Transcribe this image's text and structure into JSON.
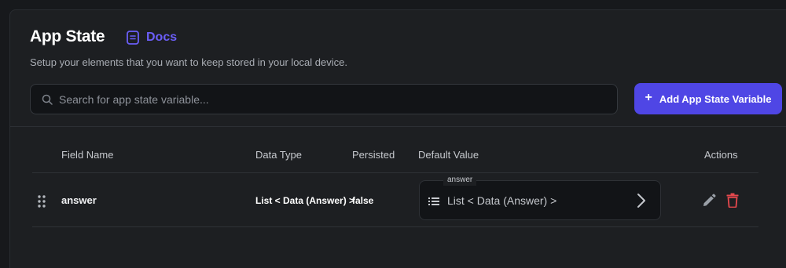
{
  "header": {
    "title": "App State",
    "docs_label": "Docs",
    "subtitle": "Setup your elements that you want to keep stored in your local device."
  },
  "search": {
    "placeholder": "Search for app state variable...",
    "value": ""
  },
  "add_button": {
    "icon": "+",
    "label": "Add App State Variable"
  },
  "table": {
    "columns": {
      "field_name": "Field Name",
      "data_type": "Data Type",
      "persisted": "Persisted",
      "default_value": "Default Value",
      "actions": "Actions"
    },
    "rows": [
      {
        "field_name": "answer",
        "data_type": "List < Data (Answer) >",
        "persisted": "false",
        "default_value": {
          "legend": "answer",
          "text": "List < Data (Answer) >"
        }
      }
    ]
  },
  "icons": {
    "docs": "docs-icon",
    "search": "search-icon",
    "drag": "drag-handle-icon",
    "list": "list-icon",
    "chevron": "chevron-right-icon",
    "edit": "pencil-icon",
    "delete": "trash-icon"
  },
  "colors": {
    "background": "#17191c",
    "panel": "#1d1f22",
    "accent": "#4f46e5",
    "docs_link": "#6b5ef8",
    "edit_icon": "#9aa0a8",
    "delete_icon": "#e5484d"
  }
}
